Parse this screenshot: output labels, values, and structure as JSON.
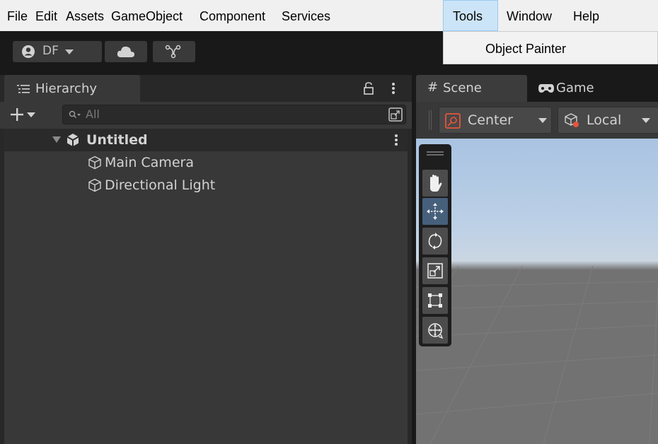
{
  "menu": {
    "items": [
      "File",
      "Edit",
      "Assets",
      "GameObject",
      "Component",
      "Services",
      "Tools",
      "Window",
      "Help"
    ],
    "active": "Tools"
  },
  "dropdown": {
    "items": [
      "Object Painter"
    ]
  },
  "toolbar": {
    "account_label": "DF"
  },
  "hierarchy": {
    "tab_label": "Hierarchy",
    "search_placeholder": "All",
    "scene_name": "Untitled",
    "objects": [
      "Main Camera",
      "Directional Light"
    ]
  },
  "scene": {
    "tabs": [
      "Scene",
      "Game"
    ],
    "pivot_label": "Center",
    "space_label": "Local",
    "tools": [
      "hand-tool",
      "move-tool",
      "rotate-tool",
      "scale-tool",
      "rect-tool",
      "transform-tool"
    ],
    "selected_tool": "move-tool"
  },
  "colors": {
    "menubar_bg": "#f0f0f0",
    "menu_active_bg": "#cce4f7",
    "panel_bg": "#383838",
    "selected_tool_bg": "#46607c",
    "accent_orange": "#e8543a"
  }
}
